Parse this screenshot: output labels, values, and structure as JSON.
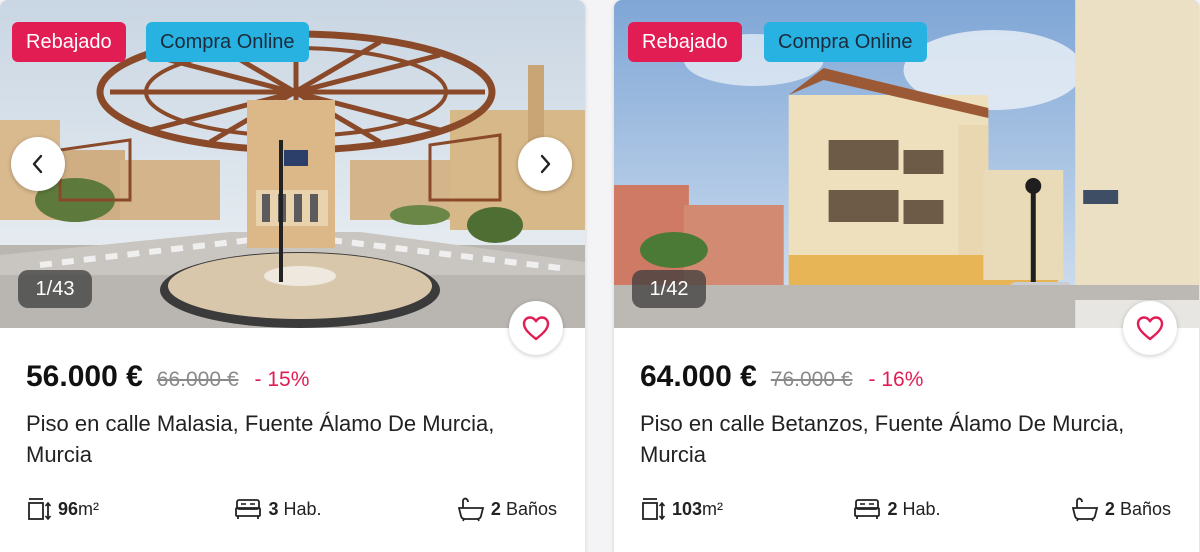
{
  "colors": {
    "tag_red": "#e11d54",
    "tag_blue": "#28b2e1",
    "discount": "#e11d54"
  },
  "listings": [
    {
      "tags": [
        "Rebajado",
        "Compra Online"
      ],
      "photo_counter": "1/43",
      "price": "56.000 €",
      "old_price": "66.000 €",
      "discount": "- 15%",
      "title": "Piso en calle Malasia, Fuente Álamo De Murcia, Murcia",
      "area": "96",
      "area_unit": "m²",
      "rooms": "3",
      "rooms_label": "Hab.",
      "baths": "2",
      "baths_label": "Baños",
      "icons": [
        "chevron-left-icon",
        "chevron-right-icon",
        "heart-icon",
        "area-icon",
        "bed-icon",
        "bath-icon"
      ]
    },
    {
      "tags": [
        "Rebajado",
        "Compra Online"
      ],
      "photo_counter": "1/42",
      "price": "64.000 €",
      "old_price": "76.000 €",
      "discount": "- 16%",
      "title": "Piso en calle Betanzos, Fuente Álamo De Murcia, Murcia",
      "area": "103",
      "area_unit": "m²",
      "rooms": "2",
      "rooms_label": "Hab.",
      "baths": "2",
      "baths_label": "Baños",
      "icons": [
        "heart-icon",
        "area-icon",
        "bed-icon",
        "bath-icon"
      ]
    }
  ]
}
